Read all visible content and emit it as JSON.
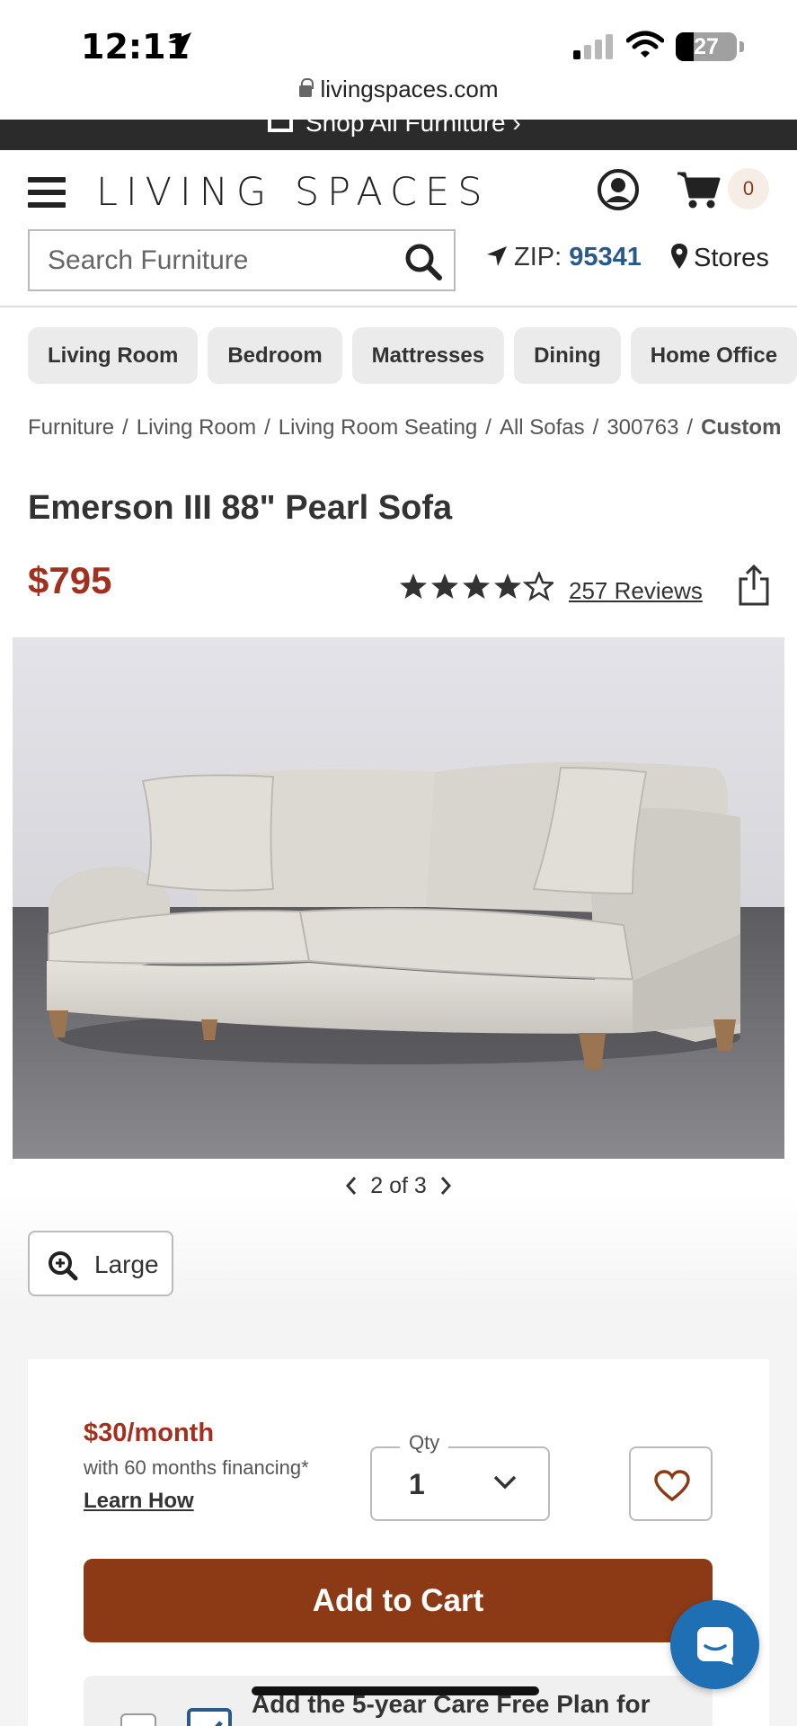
{
  "status_bar": {
    "time": "12:11",
    "battery": "27"
  },
  "browser": {
    "url": "livingspaces.com"
  },
  "promo": {
    "text": "Shop All Furniture ›"
  },
  "header": {
    "logo": "LIVING SPACES",
    "cart_count": "0",
    "search_placeholder": "Search Furniture",
    "zip_label": "ZIP:",
    "zip_value": "95341",
    "stores_label": "Stores"
  },
  "categories": [
    "Living Room",
    "Bedroom",
    "Mattresses",
    "Dining",
    "Home Office"
  ],
  "breadcrumb": {
    "items": [
      "Furniture",
      "Living Room",
      "Living Room Seating",
      "All Sofas",
      "300763"
    ],
    "separator": "/",
    "current": "Custom"
  },
  "product": {
    "title": "Emerson III 88\" Pearl Sofa",
    "price": "$795",
    "rating": 4.5,
    "reviews_label": "257 Reviews",
    "image_alt": "sofa"
  },
  "gallery": {
    "pager": "2 of 3",
    "large_label": "Large"
  },
  "purchase": {
    "monthly": "$30/month",
    "financing": "with 60 months financing*",
    "learn_how": "Learn How",
    "qty_label": "Qty",
    "qty_value": "1",
    "add_to_cart": "Add to Cart",
    "care_plan": "Add the 5-year Care Free Plan for"
  },
  "colors": {
    "brand_red": "#a2301e",
    "cart_button": "#8b3a15",
    "zip_blue": "#2a5a8a",
    "chat_blue": "#1e6fb3"
  }
}
